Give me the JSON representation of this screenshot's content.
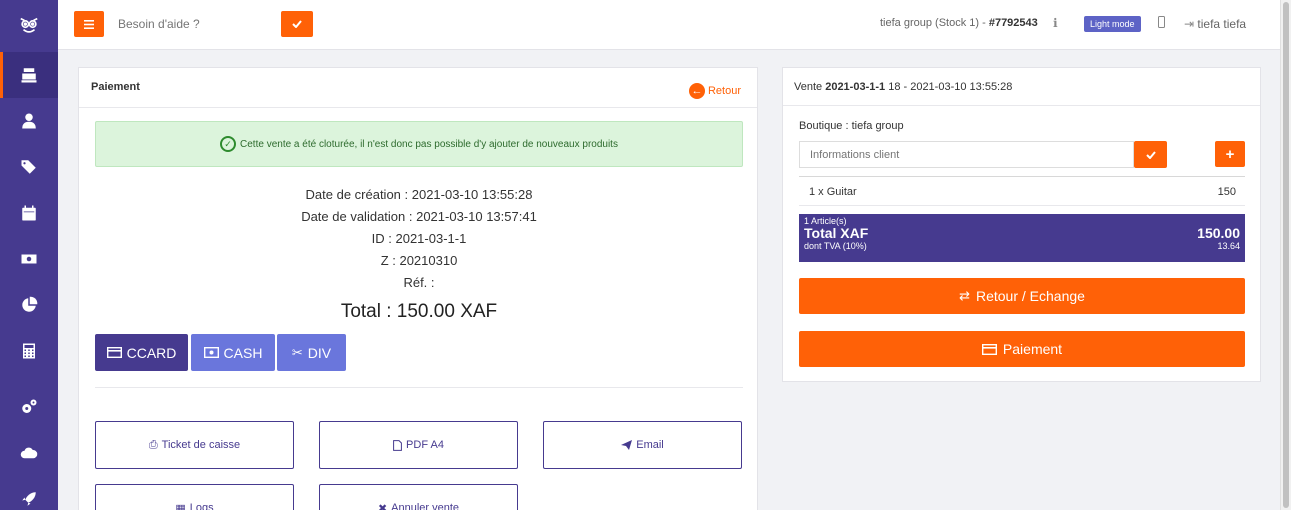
{
  "topbar": {
    "help_placeholder": "Besoin d'aide ?",
    "store_label": "tiefa group (Stock 1) - ",
    "store_id": "#7792543",
    "light_mode": "Light mode",
    "user": "tiefa tiefa"
  },
  "sidebar": {
    "items": [
      "register",
      "user",
      "tags",
      "calendar",
      "money",
      "pie-chart",
      "calculator",
      "settings",
      "cloud",
      "rocket"
    ]
  },
  "payment": {
    "title": "Paiement",
    "back_label": "Retour",
    "alert": "Cette vente a été cloturée, il n'est donc pas possible d'y ajouter de nouveaux produits",
    "creation": "Date de création : 2021-03-10 13:55:28",
    "validation": "Date de validation : 2021-03-10 13:57:41",
    "id": "ID : 2021-03-1-1",
    "z": "Z : 20210310",
    "ref": "Réf. :",
    "total": "Total : 150.00 XAF",
    "methods": [
      "CCARD",
      "CASH",
      "DIV"
    ],
    "actions": [
      "Ticket de caisse",
      "PDF A4",
      "Email",
      "Logs",
      "Annuler vente"
    ]
  },
  "sale": {
    "head_prefix": "Vente ",
    "head_id": "2021-03-1-1",
    "head_suffix": " 18 - 2021-03-10 13:55:28",
    "boutique": "Boutique : tiefa group",
    "client_placeholder": "Informations client",
    "item_label": "1 x Guitar",
    "item_price": "150",
    "articles": "1 Article(s)",
    "total_label": "Total XAF",
    "total_value": "150.00",
    "tva_label": "dont TVA (10%)",
    "tva_value": "13.64",
    "retour_echange": "Retour / Echange",
    "paiement": "Paiement"
  },
  "colors": {
    "primary": "#463a8f",
    "accent": "#ff6107",
    "secondary": "#6a76dc"
  }
}
